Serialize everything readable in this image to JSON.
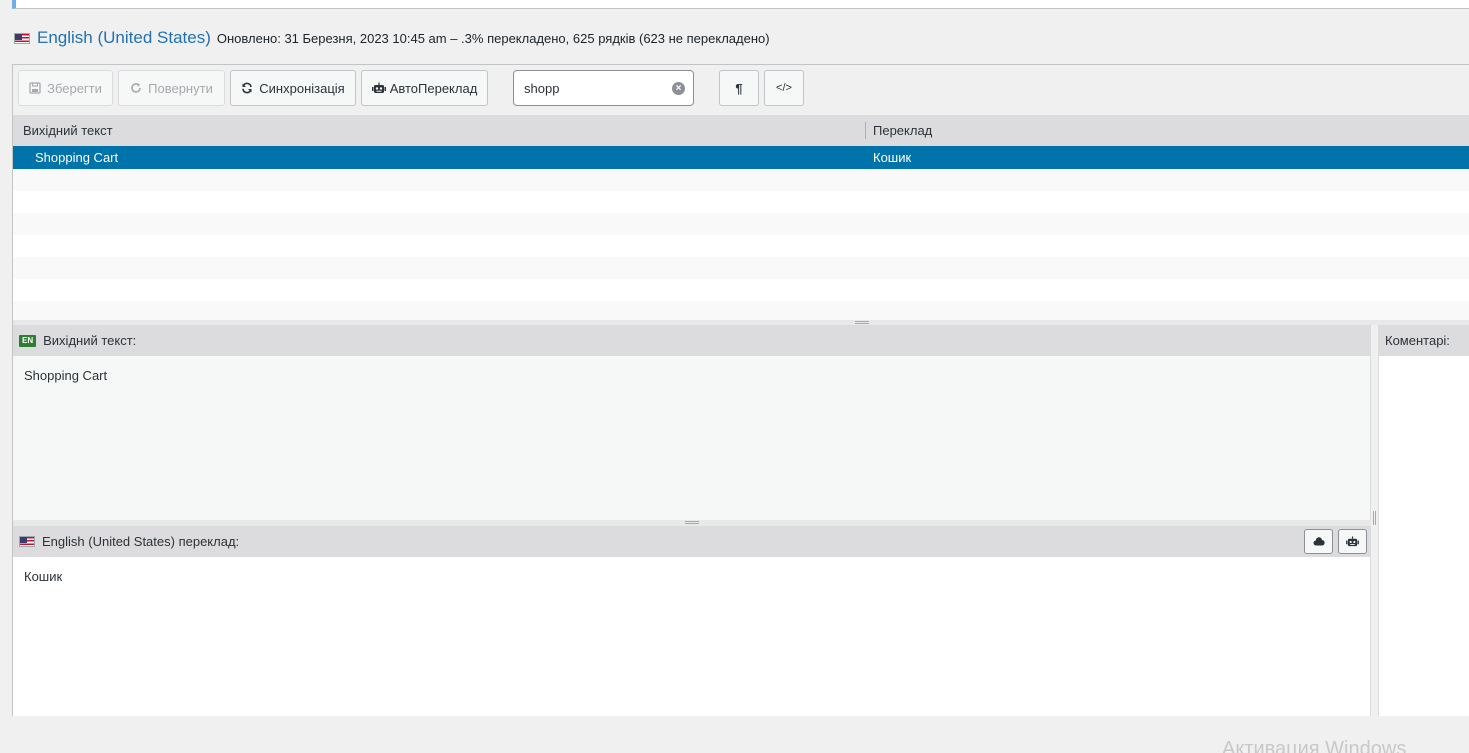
{
  "header": {
    "locale_name": "English (United States)",
    "meta": "Оновлено: 31 Березня, 2023 10:45 am – .3% перекладено, 625 рядків (623 не перекладено)"
  },
  "toolbar": {
    "save_label": "Зберегти",
    "revert_label": "Повернути",
    "sync_label": "Синхронізація",
    "autotranslate_label": "АвтоПереклад",
    "search_value": "shopp",
    "invisibles_glyph": "¶",
    "code_glyph": "</>"
  },
  "grid": {
    "source_header": "Вихідний текст",
    "translation_header": "Переклад",
    "rows": [
      {
        "source": "Shopping Cart",
        "translation": "Кошик"
      }
    ]
  },
  "source_pane": {
    "badge": "EN",
    "title": "Вихідний текст:",
    "text": "Shopping Cart"
  },
  "target_pane": {
    "title": "English (United States) переклад:",
    "text": "Кошик"
  },
  "comments_pane": {
    "title": "Коментарі:"
  },
  "os": {
    "watermark": "Активация Windows"
  },
  "colors": {
    "accent": "#2271b1",
    "selected_row": "#0073aa",
    "badge_green": "#2e7d32"
  }
}
